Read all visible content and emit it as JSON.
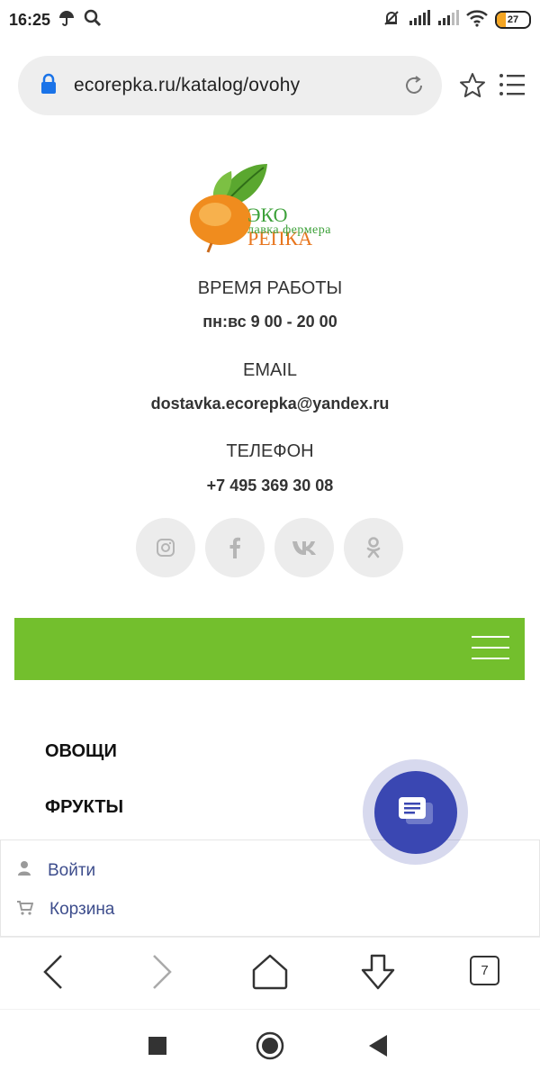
{
  "status_bar": {
    "time": "16:25",
    "battery": "27",
    "battery_level_percent": 27,
    "icons": [
      "umbrella-icon",
      "search-icon",
      "alarm-off-icon",
      "signal-icon",
      "signal-icon",
      "wifi-icon",
      "battery-icon"
    ]
  },
  "browser": {
    "url": "ecorepka.ru/katalog/ovohy",
    "tabs_count": "7",
    "icons": [
      "lock-icon",
      "reload-icon",
      "star-icon",
      "menu-icon"
    ]
  },
  "logo": {
    "line1_a": "ЭКО",
    "line1_b": "РЕПКА",
    "line2": "лавка фермера"
  },
  "contacts": {
    "hours_label": "ВРЕМЯ РАБОТЫ",
    "hours_value": "пн:вс 9 00 - 20 00",
    "email_label": "EMAIL",
    "email_value": "dostavka.ecorepka@yandex.ru",
    "phone_label": "ТЕЛЕФОН",
    "phone_value": "+7 495 369 30 08"
  },
  "socials": [
    "instagram-icon",
    "facebook-icon",
    "vk-icon",
    "odnoklassniki-icon"
  ],
  "nav": {
    "items": [
      {
        "label": "ОВОЩИ"
      },
      {
        "label": "ФРУКТЫ"
      }
    ]
  },
  "account": {
    "login_label": "Войти",
    "cart_label": "Корзина"
  },
  "colors": {
    "accent_green": "#73bf2d",
    "chat_blue": "#3a47b2",
    "link_blue": "#3d4d8c",
    "battery_orange": "#f5a623"
  }
}
